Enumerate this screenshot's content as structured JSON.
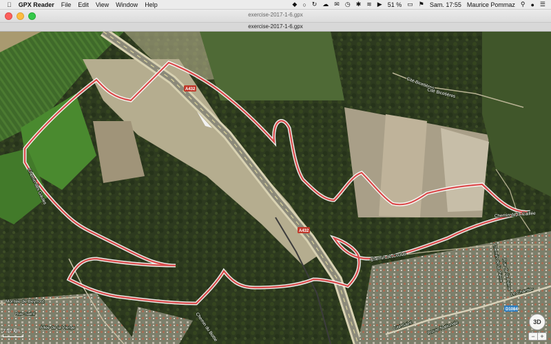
{
  "menubar": {
    "apple_icon": "apple-icon",
    "app_name": "GPX Reader",
    "menus": [
      "File",
      "Edit",
      "View",
      "Window",
      "Help"
    ],
    "battery": "51 %",
    "clock": "Sam. 17:55",
    "user": "Maurice Pommaz"
  },
  "window": {
    "title": "exercise-2017-1-6.gpx",
    "document": "exercise-2017-1-6.gpx"
  },
  "map": {
    "track_color": "#d94a4a",
    "labels": {
      "road_a432_1": "A432",
      "road_a432_2": "A432",
      "cite_bicetieres": "Cité Bicetières",
      "cite_bicetieres_2": "Cité Bicetières",
      "chemin_coutat": "Chemin de Coutat",
      "chemin_de_la_caillee": "Chemin de la Caillée",
      "chemin_de_la_pierre": "Chemin de la Pierre",
      "montee_de_beynost": "Montée de Beynost",
      "route_nationale": "Route Nationale",
      "d1084": "D1084",
      "cite_saint": "Cité Saint",
      "le_chantier": "Le Chantier",
      "rue_saint": "Rue Saint",
      "allee_vierge": "Allée de la Vierge",
      "chemin_bottie": "Chemin du Bottie",
      "rue_de_la_pierre": "Rue de la Pierre",
      "chemin_des_gaules": "Chemin des Gaules"
    },
    "scale": "7.57 km",
    "button_3d": "3D",
    "zoom_out": "−",
    "zoom_in": "+"
  }
}
